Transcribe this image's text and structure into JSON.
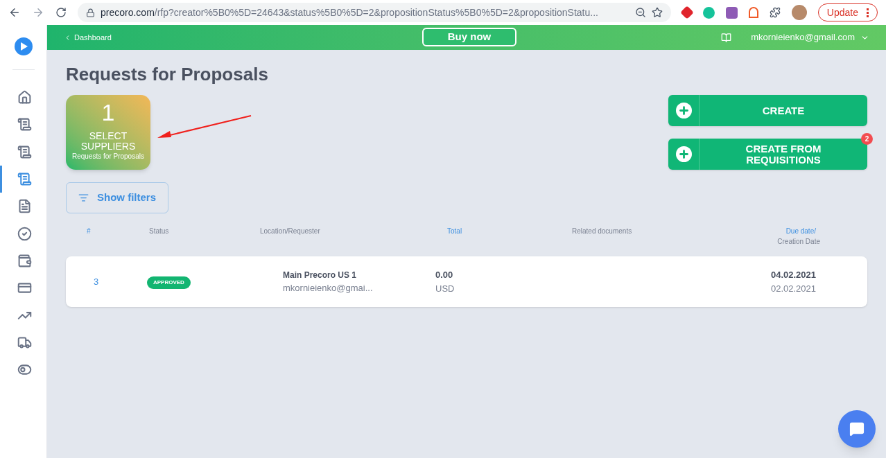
{
  "browser": {
    "url_host": "precoro.com",
    "url_path": "/rfp?creator%5B0%5D=24643&status%5B0%5D=2&propositionStatus%5B0%5D=2&propositionStatu...",
    "update_button": "Update"
  },
  "sidebar": {
    "items": [
      {
        "selected": false
      },
      {
        "selected": false
      },
      {
        "selected": false
      },
      {
        "selected": true
      },
      {
        "selected": false
      },
      {
        "selected": false
      },
      {
        "selected": false
      },
      {
        "selected": false
      },
      {
        "selected": false
      },
      {
        "selected": false
      },
      {
        "selected": false
      }
    ]
  },
  "header": {
    "back_link": "Dashboard",
    "buy_button": "Buy now",
    "user": "mkornieienko@gmail.com"
  },
  "page": {
    "title": "Requests for Proposals"
  },
  "summary_card": {
    "count": "1",
    "label": "SELECT SUPPLIERS",
    "sublabel": "Requests for Proposals"
  },
  "actions": [
    {
      "label": "CREATE"
    },
    {
      "label": "CREATE FROM REQUISITIONS",
      "badge": "2"
    }
  ],
  "filters_button": "Show filters",
  "table": {
    "columns": [
      {
        "label": "#",
        "sortable": true
      },
      {
        "label": "Status",
        "sortable": false
      },
      {
        "label": "Location/Requester",
        "sortable": false
      },
      {
        "label": "Total",
        "sortable": true
      },
      {
        "label": "Related documents",
        "sortable": false
      },
      {
        "label": "Due date/",
        "sortable": true,
        "sub": "Creation Date"
      }
    ],
    "rows": [
      {
        "number": "3",
        "status": "APPROVED",
        "location": "Main Precoro US 1",
        "requester": "mkornieienko@gmai...",
        "total": "0.00",
        "currency": "USD",
        "due_date": "04.02.2021",
        "creation_date": "02.02.2021"
      }
    ]
  }
}
